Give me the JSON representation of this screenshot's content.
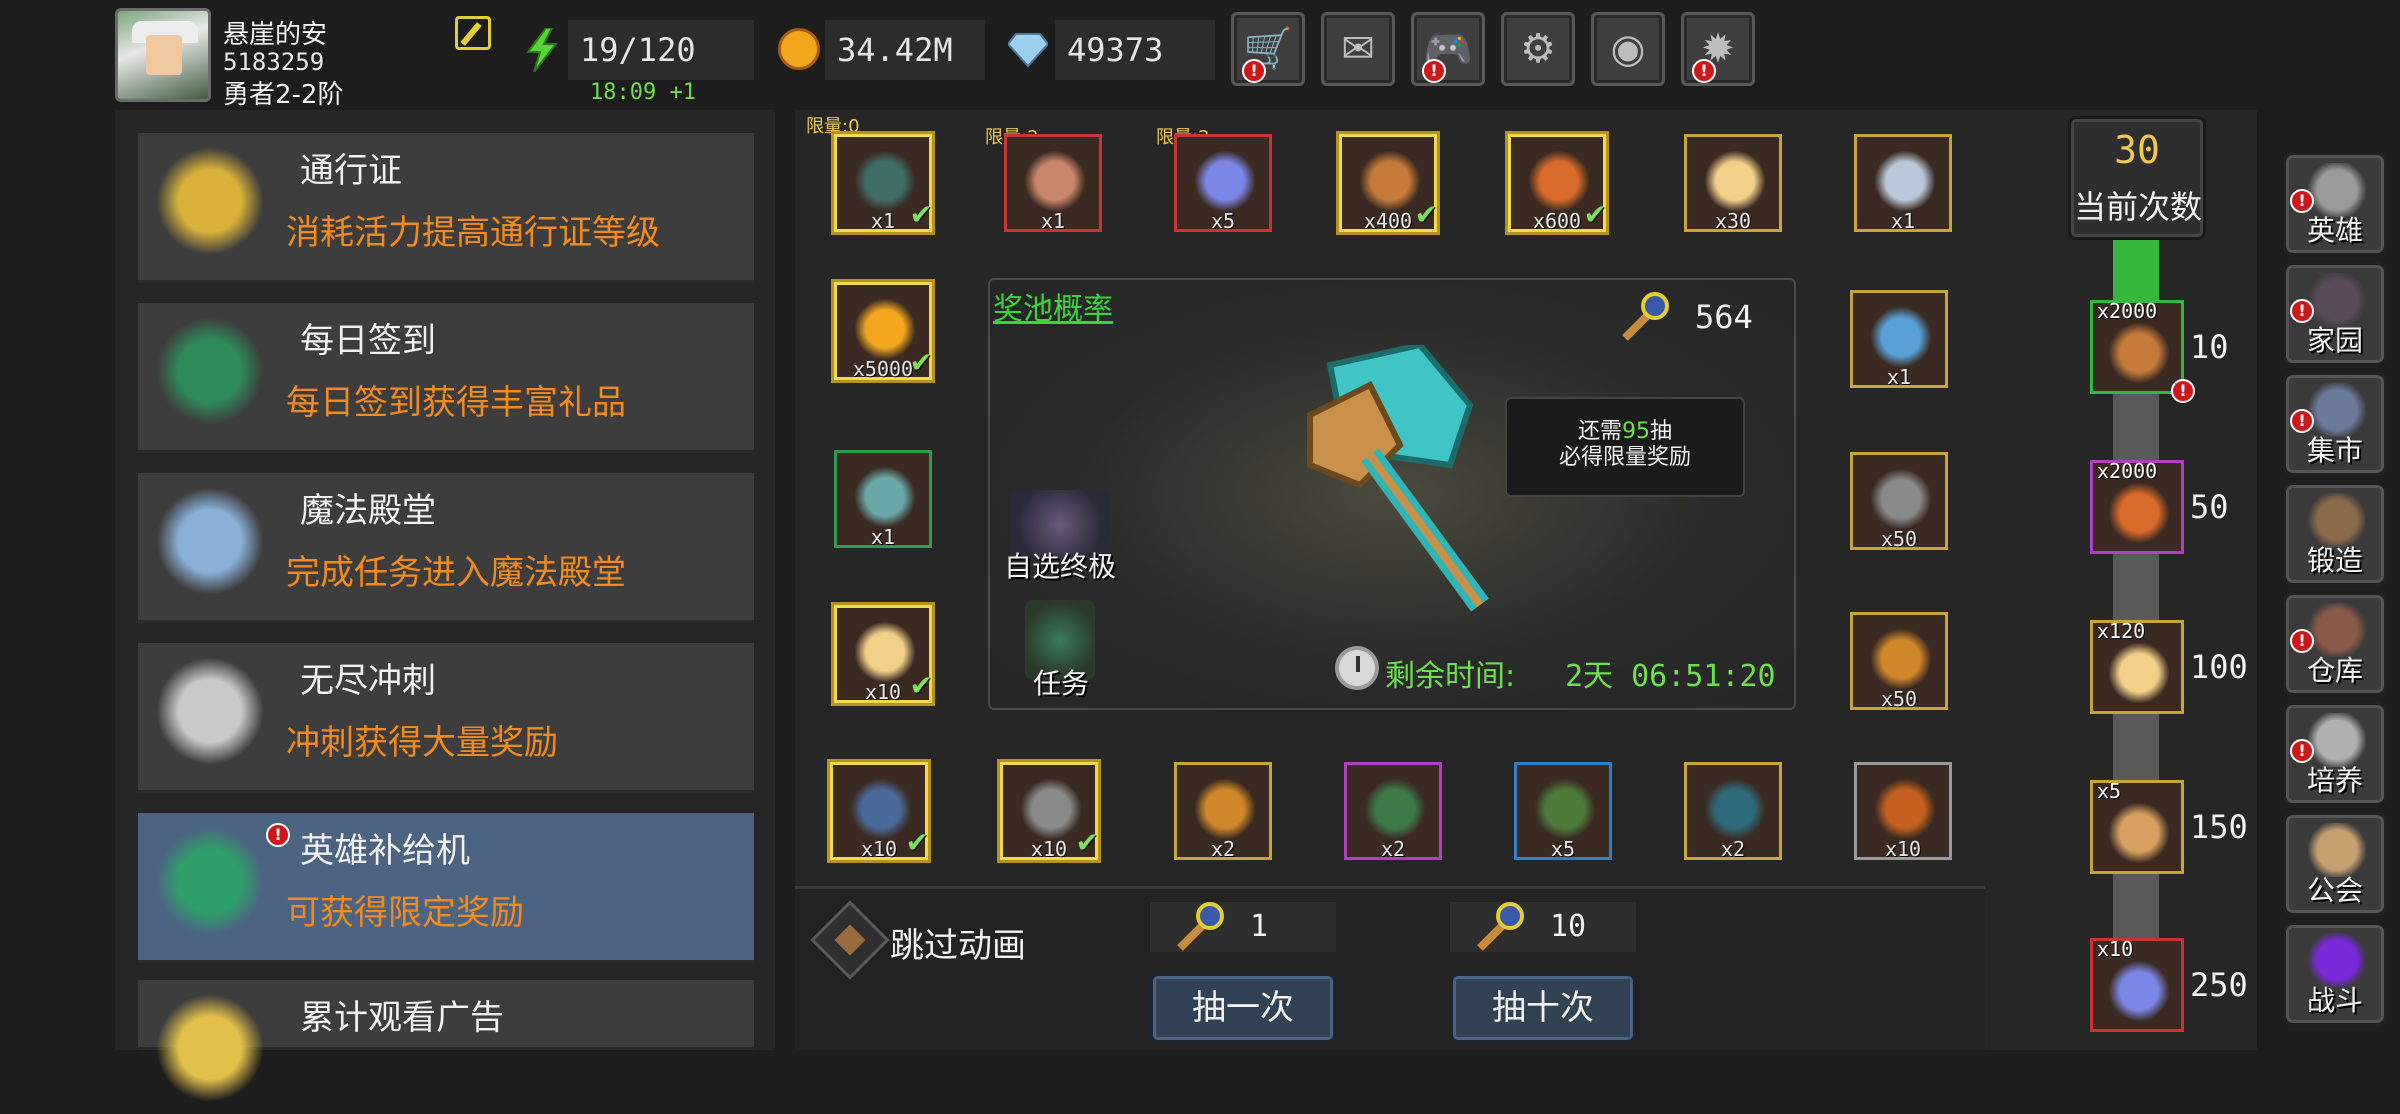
{
  "player": {
    "name": "悬崖的安",
    "id": "5183259",
    "rank": "勇者2-2阶"
  },
  "resources": {
    "energy": "19/120",
    "energy_timer": "18:09 +1",
    "gold": "34.42M",
    "gems": "49373"
  },
  "top_buttons": [
    {
      "name": "shop-icon",
      "glyph": "🛒",
      "alert": true
    },
    {
      "name": "mail-icon",
      "glyph": "✉",
      "alert": false
    },
    {
      "name": "gamepad-icon",
      "glyph": "🎮",
      "alert": true
    },
    {
      "name": "gear-icon",
      "glyph": "⚙",
      "alert": false
    },
    {
      "name": "color-wheel-icon",
      "glyph": "◉",
      "alert": false
    },
    {
      "name": "fireworks-icon",
      "glyph": "✹",
      "alert": true
    }
  ],
  "menu": [
    {
      "title": "通行证",
      "desc": "消耗活力提高通行证等级",
      "icon": "goblet-icon",
      "active": false,
      "alert": false
    },
    {
      "title": "每日签到",
      "desc": "每日签到获得丰富礼品",
      "icon": "chest-icon",
      "active": false,
      "alert": false
    },
    {
      "title": "魔法殿堂",
      "desc": "完成任务进入魔法殿堂",
      "icon": "crystal-icon",
      "active": false,
      "alert": false
    },
    {
      "title": "无尽冲刺",
      "desc": "冲刺获得大量奖励",
      "icon": "trophy-icon",
      "active": false,
      "alert": false
    },
    {
      "title": "英雄补给机",
      "desc": "可获得限定奖励",
      "icon": "supply-crate-icon",
      "active": true,
      "alert": true
    },
    {
      "title": "累计观看广告",
      "desc": "",
      "icon": "gold-coin-pile-icon",
      "active": false,
      "alert": false
    }
  ],
  "limits": {
    "first": "限量:0",
    "second": "限量:2",
    "third": "限量:2"
  },
  "rewards_top": [
    {
      "name": "axe-reward-icon",
      "qty": "x1",
      "checked": true,
      "border": "gold",
      "color": "#3f6e68"
    },
    {
      "name": "scroll-reward-icon",
      "qty": "x1",
      "checked": false,
      "border": "red",
      "color": "#c9866a"
    },
    {
      "name": "star-crystal-reward-icon",
      "qty": "x5",
      "checked": false,
      "border": "red",
      "color": "#7b86e6"
    },
    {
      "name": "bone-reward-icon",
      "qty": "x400",
      "checked": true,
      "border": "gold",
      "color": "#c57a3a"
    },
    {
      "name": "flame-stone-reward-icon",
      "qty": "x600",
      "checked": true,
      "border": "gold",
      "color": "#d86a2a"
    },
    {
      "name": "egg-reward-icon",
      "qty": "x30",
      "checked": false,
      "border": "orange",
      "color": "#f2d08a"
    },
    {
      "name": "dagger-reward-icon",
      "qty": "x1",
      "checked": false,
      "border": "orange",
      "color": "#b9c8d8"
    }
  ],
  "rewards_left": [
    {
      "name": "gold-coin-reward-icon",
      "qty": "x5000",
      "checked": true,
      "border": "gold",
      "color": "#f2a61e"
    },
    {
      "name": "treasure-chest-reward-icon",
      "qty": "x1",
      "checked": false,
      "border": "green",
      "color": "#6aa8a8"
    },
    {
      "name": "egg-reward-icon",
      "qty": "x10",
      "checked": true,
      "border": "gold",
      "color": "#f2d08a"
    }
  ],
  "rewards_right": [
    {
      "name": "mirror-reward-icon",
      "qty": "x1",
      "checked": false,
      "border": "orange",
      "color": "#5aa0d8"
    },
    {
      "name": "hammer-reward-icon",
      "qty": "x50",
      "checked": false,
      "border": "orange",
      "color": "#8a8a8a"
    },
    {
      "name": "spark-shard-reward-icon",
      "qty": "x50",
      "checked": false,
      "border": "orange",
      "color": "#d0872a"
    }
  ],
  "rewards_bottom": [
    {
      "name": "ore-reward-icon",
      "qty": "x10",
      "checked": true,
      "border": "gold",
      "color": "#4a6a9a"
    },
    {
      "name": "mace-reward-icon",
      "qty": "x10",
      "checked": true,
      "border": "gold",
      "color": "#8a8a8a"
    },
    {
      "name": "rune-medal-reward-icon",
      "qty": "x2",
      "checked": false,
      "border": "orange",
      "color": "#d0872a"
    },
    {
      "name": "green-gem-reward-icon",
      "qty": "x2",
      "checked": false,
      "border": "purple",
      "color": "#3d7a4a"
    },
    {
      "name": "green-rune-reward-icon",
      "qty": "x5",
      "checked": false,
      "border": "blue",
      "color": "#4e7a3a"
    },
    {
      "name": "blue-book-reward-icon",
      "qty": "x2",
      "checked": false,
      "border": "orange",
      "color": "#2f6a7a"
    },
    {
      "name": "orange-book-reward-icon",
      "qty": "x10",
      "checked": false,
      "border": "gray",
      "color": "#c5601e"
    }
  ],
  "pool": {
    "link": "奖池概率",
    "key_count": "564",
    "tip_prefix": "还需",
    "tip_num": "95",
    "tip_suffix": "抽",
    "tip_line2": "必得限量奖励",
    "choose_label": "自选终极",
    "task_label": "任务",
    "remain_label": "剩余时间:",
    "remain_value": "2天 06:51:20"
  },
  "draw": {
    "skip_label": "跳过动画",
    "cost_one": "1",
    "cost_ten": "10",
    "btn_one": "抽一次",
    "btn_ten": "抽十次"
  },
  "progress": {
    "current_count": "30",
    "current_label": "当前次数",
    "filled_fraction": 0.08,
    "milestones": [
      {
        "badge": "x2000",
        "threshold": "10",
        "border": "#35b93c",
        "color": "#c57a3a",
        "name": "bone-milestone-icon",
        "alert": true
      },
      {
        "badge": "x2000",
        "threshold": "50",
        "border": "#b13fc4",
        "color": "#d86a2a",
        "name": "flame-stone-milestone-icon",
        "alert": false
      },
      {
        "badge": "x120",
        "threshold": "100",
        "border": "#c9a438",
        "color": "#f2d08a",
        "name": "egg-milestone-icon",
        "alert": false
      },
      {
        "badge": "x5",
        "threshold": "150",
        "border": "#c9a438",
        "color": "#d8a060",
        "name": "key-milestone-icon",
        "alert": false
      },
      {
        "badge": "x10",
        "threshold": "250",
        "border": "#c83535",
        "color": "#7b86e6",
        "name": "star-crystal-milestone-icon",
        "alert": false
      }
    ]
  },
  "nav": [
    {
      "label": "英雄",
      "icon": "helmet-icon",
      "alert": true,
      "color": "#9a9a9a"
    },
    {
      "label": "家园",
      "icon": "castle-icon",
      "alert": true,
      "color": "#5a4a5a"
    },
    {
      "label": "集市",
      "icon": "market-stall-icon",
      "alert": true,
      "color": "#6a7a9a"
    },
    {
      "label": "锻造",
      "icon": "anvil-icon",
      "alert": false,
      "color": "#8a6a4a"
    },
    {
      "label": "仓库",
      "icon": "warehouse-icon",
      "alert": true,
      "color": "#8a5a4a"
    },
    {
      "label": "培养",
      "icon": "goblet-nav-icon",
      "alert": true,
      "color": "#b0b0b0"
    },
    {
      "label": "公会",
      "icon": "guild-icon",
      "alert": false,
      "color": "#c6a070"
    },
    {
      "label": "战斗",
      "icon": "portal-icon",
      "alert": false,
      "color": "#7a2ad8"
    }
  ]
}
